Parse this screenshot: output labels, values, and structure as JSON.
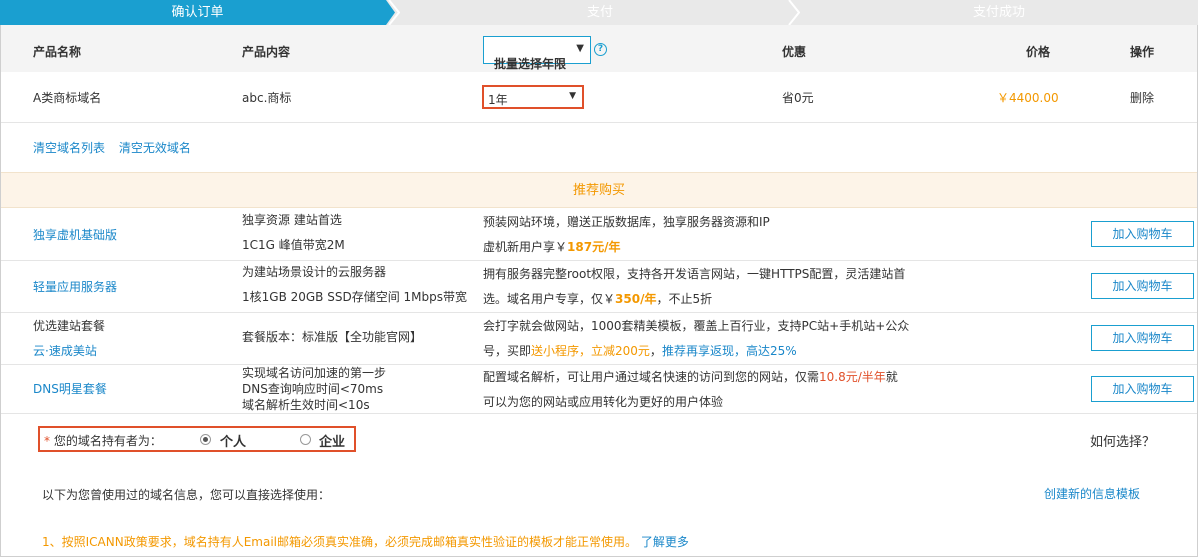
{
  "steps": [
    "确认订单",
    "支付",
    "支付成功"
  ],
  "colors": {
    "accent": "#1a9fd0",
    "orange": "#f39800",
    "red": "#e0502a",
    "link": "#1a87c9"
  },
  "table_header": {
    "product_name": "产品名称",
    "product_content": "产品内容",
    "batch_select": "批量选择年限",
    "discount": "优惠",
    "price": "价格",
    "action": "操作"
  },
  "product": {
    "name": "A类商标域名",
    "content": "abc.商标",
    "years": "1年",
    "discount": "省0元",
    "price": "￥4400.00",
    "delete": "删除"
  },
  "clear_links": {
    "clear_list": "清空域名列表",
    "clear_invalid": "清空无效域名"
  },
  "recommend": {
    "title": "推荐购买",
    "cart_label": "加入购物车",
    "items": [
      {
        "name": "独享虚机基础版",
        "spec1": "独享资源 建站首选",
        "spec2": "1C1G 峰值带宽2M",
        "desc1": "预装网站环境，赠送正版数据库，独享服务器资源和IP",
        "desc2a": "虚机新用户享￥",
        "desc2b": "187元/年"
      },
      {
        "name": "轻量应用服务器",
        "spec1": "为建站场景设计的云服务器",
        "spec2": "1核1GB 20GB SSD存储空间 1Mbps带宽",
        "desc1": "拥有服务器完整root权限，支持各开发语言网站，一键HTTPS配置，灵活建站首",
        "desc2a": "选。域名用户专享，仅￥",
        "desc2b": "350/年",
        "desc2c": "，不止5折"
      },
      {
        "name": "优选建站套餐",
        "sub": "云·速成美站",
        "spec1": "套餐版本：标准版【全功能官网】",
        "desc1": "会打字就会做网站，1000套精美模板，覆盖上百行业，支持PC站+手机站+公众",
        "desc2a": "号，买即",
        "desc2b": "送小程序，立减200元",
        "desc2c": "，",
        "desc2d": "推荐再享返现，高达25%"
      },
      {
        "name": "DNS明星套餐",
        "spec1": "实现域名访问加速的第一步",
        "spec2": "DNS查询响应时间<70ms",
        "spec3": "域名解析生效时间<10s",
        "desc1a": "配置域名解析，可让用户通过域名快速的访问到您的网站，仅需",
        "desc1b": "10.8元/半年",
        "desc1c": "就",
        "desc2": "可以为您的网站或应用转化为更好的用户体验"
      }
    ]
  },
  "owner": {
    "required_mark": "*",
    "label": "您的域名持有者为：",
    "option_personal": "个人",
    "option_company": "企业",
    "selected": "个人",
    "how_to_choose": "如何选择？"
  },
  "info": {
    "used_info": "以下为您曾使用过的域名信息，您可以直接选择使用：",
    "create_template": "创建新的信息模板",
    "notice": "1、按照ICANN政策要求，域名持有人Email邮箱必须真实准确，必须完成邮箱真实性验证的模板才能正常使用。",
    "learn_more": "了解更多"
  }
}
